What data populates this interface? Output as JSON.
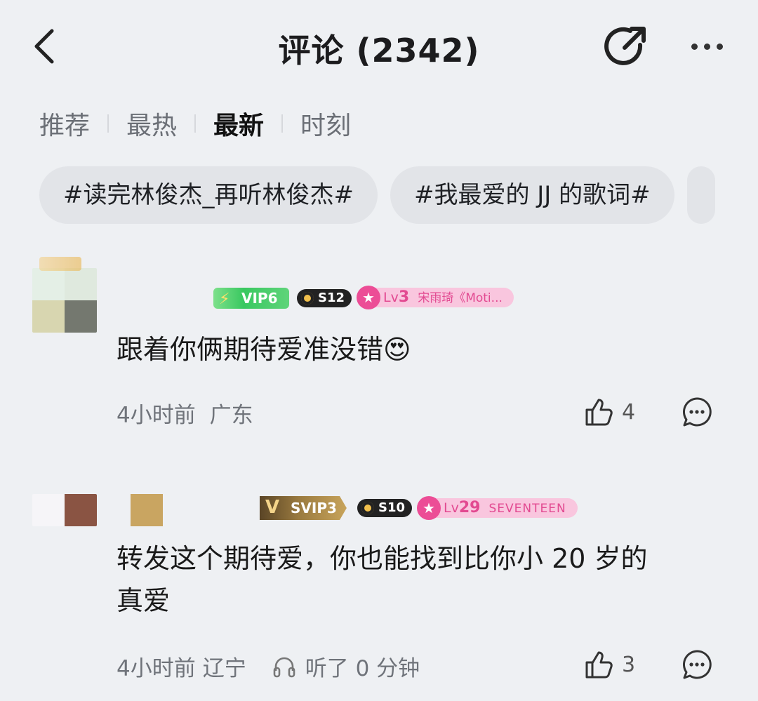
{
  "header": {
    "title": "评论 (2342)"
  },
  "tabs": [
    {
      "label": "推荐",
      "active": false
    },
    {
      "label": "最热",
      "active": false
    },
    {
      "label": "最新",
      "active": true
    },
    {
      "label": "时刻",
      "active": false
    }
  ],
  "topics": [
    "#读完林俊杰_再听林俊杰#",
    "#我最爱的 JJ 的歌词#"
  ],
  "comments": [
    {
      "badges": {
        "vip": "VIP6",
        "season": "S12",
        "fan_level": "Lv",
        "fan_level_num": "3",
        "fan_name": "宋雨琦《Moti..."
      },
      "text": "跟着你俩期待爱准没错😍",
      "time": "4小时前",
      "location": "广东",
      "likes": "4"
    },
    {
      "badges": {
        "vip": "SVIP3",
        "season": "S10",
        "fan_level": "Lv",
        "fan_level_num": "29",
        "fan_name": "SEVENTEEN"
      },
      "text_line1": "转发这个期待爱，你也能找到比你小 20 岁的",
      "text_line2": "真爱",
      "time": "4小时前",
      "location": "辽宁",
      "listen": "听了 0 分钟",
      "likes": "3"
    }
  ],
  "icons": {
    "back": "chevron-left-icon",
    "share": "share-icon",
    "more": "more-icon",
    "like": "thumbs-up-icon",
    "reply": "comment-bubble-icon",
    "headphones": "headphones-icon"
  }
}
